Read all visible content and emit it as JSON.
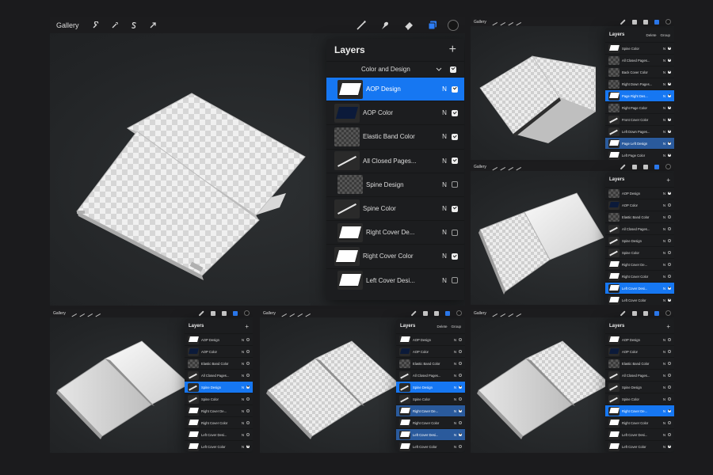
{
  "colors": {
    "accent": "#1677f2",
    "accent_dim": "#2a5a9c",
    "toolbar": "#1c1c1e",
    "panel_bg": "#1c1d1f",
    "canvas": "#27292b"
  },
  "toolbar": {
    "gallery": "Gallery",
    "tools_left": [
      "wrench-icon",
      "magic-wand-icon",
      "selection-s-icon",
      "transform-arrow-icon"
    ],
    "tools_right": [
      "brush-icon",
      "smudge-icon",
      "eraser-icon",
      "layers-icon",
      "color-well"
    ]
  },
  "layers_panel": {
    "title": "Layers",
    "add": "+",
    "delete": "Delete",
    "group": "Group",
    "blend_mode": "N"
  },
  "main": {
    "group": {
      "name": "Color and Design",
      "visible": true,
      "expanded": true
    },
    "layers": [
      {
        "name": "AOP Design",
        "thumb": "white",
        "visible": true,
        "selected": true,
        "indent": true
      },
      {
        "name": "AOP Color",
        "thumb": "navy",
        "visible": true
      },
      {
        "name": "Elastic Band Color",
        "thumb": "checker",
        "visible": true
      },
      {
        "name": "All Closed Pages...",
        "thumb": "line",
        "visible": true
      },
      {
        "name": "Spine Design",
        "thumb": "checker",
        "visible": false,
        "indent": true
      },
      {
        "name": "Spine Color",
        "thumb": "line",
        "visible": true
      },
      {
        "name": "Right Cover De...",
        "thumb": "white",
        "visible": false,
        "indent": true
      },
      {
        "name": "Right Cover Color",
        "thumb": "white",
        "visible": true
      },
      {
        "name": "Left Cover Desi...",
        "thumb": "white",
        "visible": false,
        "indent": true
      }
    ]
  },
  "top_right": {
    "layers": [
      {
        "name": "Spine Color",
        "thumb": "white",
        "visible": true
      },
      {
        "name": "All Closed Pages...",
        "thumb": "checker",
        "visible": true
      },
      {
        "name": "Back Cover Color",
        "thumb": "checker",
        "visible": true
      },
      {
        "name": "Right Down Pages...",
        "thumb": "checker",
        "visible": true
      },
      {
        "name": "Page Right Des...",
        "thumb": "white",
        "visible": true,
        "selected": true
      },
      {
        "name": "Right Page Color",
        "thumb": "checker",
        "visible": true
      },
      {
        "name": "Front Cover Color",
        "thumb": "line",
        "visible": true
      },
      {
        "name": "Left Down Pages...",
        "thumb": "line",
        "visible": true
      },
      {
        "name": "Page Left Design",
        "thumb": "white",
        "visible": true,
        "selected2": true
      },
      {
        "name": "Left Page Color",
        "thumb": "white",
        "visible": true
      }
    ]
  },
  "middle_right": {
    "layers": [
      {
        "name": "AOP Design",
        "thumb": "checker",
        "visible": true
      },
      {
        "name": "AOP Color",
        "thumb": "navy",
        "visible": false
      },
      {
        "name": "Elastic Band Color",
        "thumb": "checker",
        "visible": false
      },
      {
        "name": "All Closed Pages...",
        "thumb": "line",
        "visible": false
      },
      {
        "name": "Spine Design",
        "thumb": "line",
        "visible": false
      },
      {
        "name": "Spine Color",
        "thumb": "line",
        "visible": false
      },
      {
        "name": "Right Cover De...",
        "thumb": "white",
        "visible": false
      },
      {
        "name": "Right Cover Color",
        "thumb": "white",
        "visible": false
      },
      {
        "name": "Left Cover Desi...",
        "thumb": "white",
        "visible": true,
        "selected": true
      },
      {
        "name": "Left Cover Color",
        "thumb": "white",
        "visible": true
      }
    ]
  },
  "bottom_left": {
    "layers": [
      {
        "name": "AOP Design",
        "thumb": "white",
        "visible": false
      },
      {
        "name": "AOP Color",
        "thumb": "navy",
        "visible": false
      },
      {
        "name": "Elastic Band Color",
        "thumb": "checker",
        "visible": false
      },
      {
        "name": "All Closed Pages...",
        "thumb": "line",
        "visible": false
      },
      {
        "name": "Spine Design",
        "thumb": "line",
        "visible": true,
        "selected": true
      },
      {
        "name": "Spine Color",
        "thumb": "line",
        "visible": false
      },
      {
        "name": "Right Cover De...",
        "thumb": "white",
        "visible": false
      },
      {
        "name": "Right Cover Color",
        "thumb": "white",
        "visible": false
      },
      {
        "name": "Left Cover Desi...",
        "thumb": "white",
        "visible": false
      },
      {
        "name": "Left Cover Color",
        "thumb": "white",
        "visible": true
      }
    ]
  },
  "bottom_middle": {
    "layers": [
      {
        "name": "AOP Design",
        "thumb": "white",
        "visible": false
      },
      {
        "name": "AOP Color",
        "thumb": "navy",
        "visible": false
      },
      {
        "name": "Elastic Band Color",
        "thumb": "checker",
        "visible": false
      },
      {
        "name": "All Closed Pages...",
        "thumb": "line",
        "visible": false
      },
      {
        "name": "Spine Design",
        "thumb": "line",
        "visible": true,
        "selected": true
      },
      {
        "name": "Spine Color",
        "thumb": "line",
        "visible": false
      },
      {
        "name": "Right Cover De...",
        "thumb": "white",
        "visible": true,
        "selected2": true
      },
      {
        "name": "Right Cover Color",
        "thumb": "white",
        "visible": false
      },
      {
        "name": "Left Cover Desi...",
        "thumb": "white",
        "visible": true,
        "selected2": true
      },
      {
        "name": "Left Cover Color",
        "thumb": "white",
        "visible": false
      }
    ]
  },
  "bottom_right": {
    "layers": [
      {
        "name": "AOP Design",
        "thumb": "white",
        "visible": false
      },
      {
        "name": "AOP Color",
        "thumb": "navy",
        "visible": false
      },
      {
        "name": "Elastic Band Color",
        "thumb": "checker",
        "visible": false
      },
      {
        "name": "All Closed Pages...",
        "thumb": "line",
        "visible": false
      },
      {
        "name": "Spine Design",
        "thumb": "line",
        "visible": false
      },
      {
        "name": "Spine Color",
        "thumb": "line",
        "visible": false
      },
      {
        "name": "Right Cover De...",
        "thumb": "white",
        "visible": true,
        "selected": true
      },
      {
        "name": "Right Cover Color",
        "thumb": "white",
        "visible": false
      },
      {
        "name": "Left Cover Desi...",
        "thumb": "white",
        "visible": false
      },
      {
        "name": "Left Cover Color",
        "thumb": "white",
        "visible": true
      }
    ]
  }
}
